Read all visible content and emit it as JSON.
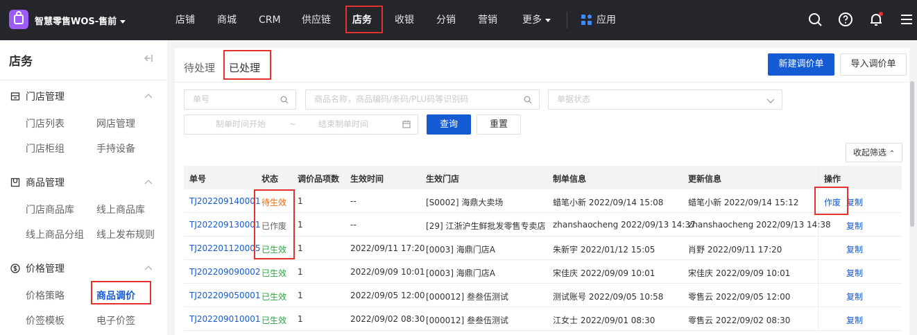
{
  "app": {
    "title": "智慧零售WOS-售前"
  },
  "nav": {
    "items": [
      "店铺",
      "商城",
      "CRM",
      "供应链",
      "店务",
      "收银",
      "分销",
      "营销",
      "更多"
    ],
    "apps_label": "应用",
    "active": "店务"
  },
  "toolbar_icons": [
    "search-icon",
    "help-icon",
    "bell-icon",
    "menu-icon"
  ],
  "sidebar": {
    "title": "店务",
    "groups": [
      {
        "label": "门店管理",
        "icon": "store-icon",
        "items": [
          "门店列表",
          "网店管理",
          "门店柜组",
          "手持设备"
        ]
      },
      {
        "label": "商品管理",
        "icon": "goods-icon",
        "items": [
          "门店商品库",
          "线上商品库",
          "线上商品分组",
          "线上发布规则"
        ]
      },
      {
        "label": "价格管理",
        "icon": "price-icon",
        "items": [
          "价格策略",
          "商品调价",
          "价签模板",
          "电子价签"
        ]
      }
    ],
    "active_item": "商品调价"
  },
  "tabs": {
    "pending": "待处理",
    "processed": "已处理"
  },
  "actions": {
    "new": "新建调价单",
    "import": "导入调价单"
  },
  "filters": {
    "order_no": "单号",
    "product": "商品名称，商品编码/条码/PLU码等识别码",
    "status": "单据状态",
    "date_start": "制单时间开始",
    "date_sep": "~",
    "date_end": "结束制单时间",
    "query": "查询",
    "reset": "重置",
    "collapse": "收起筛选"
  },
  "table": {
    "headers": [
      "单号",
      "状态",
      "调价品项数",
      "生效时间",
      "生效门店",
      "制单信息",
      "更新信息",
      "操作"
    ],
    "rows": [
      {
        "no": "TJ202209140001",
        "status": "待生效",
        "count": "1",
        "time": "--",
        "store": "[S0002] 海鼎大卖场",
        "creator": "蜡笔小新 2022/09/14 15:08",
        "updater": "蜡笔小新 2022/09/14 15:12",
        "ops": [
          "作废",
          "复制"
        ]
      },
      {
        "no": "TJ202209130001",
        "status": "已作废",
        "count": "1",
        "time": "--",
        "store": "[29] 江浙沪生鲜批发零售专卖店",
        "creator": "zhanshaocheng 2022/09/13 14:37",
        "updater": "zhanshaocheng 2022/09/13 14:38",
        "ops": [
          "复制"
        ]
      },
      {
        "no": "TJ202201120005",
        "status": "已生效",
        "count": "1",
        "time": "2022/09/11 17:20",
        "store": "[0003] 海鼎门店A",
        "creator": "朱新宇 2022/01/12 15:05",
        "updater": "肖野 2022/09/11 17:20",
        "ops": [
          "复制"
        ]
      },
      {
        "no": "TJ202209090002",
        "status": "已生效",
        "count": "1",
        "time": "2022/09/09 10:01",
        "store": "[0003] 海鼎门店A",
        "creator": "宋佳庆 2022/09/09 10:01",
        "updater": "宋佳庆 2022/09/09 10:01",
        "ops": [
          "复制"
        ]
      },
      {
        "no": "TJ202209050001",
        "status": "已生效",
        "count": "1",
        "time": "2022/09/05 12:00",
        "store": "[000012] 叁叁伍测试",
        "creator": "测试账号 2022/09/05 10:58",
        "updater": "零售云 2022/09/05 12:00",
        "ops": [
          "复制"
        ]
      },
      {
        "no": "TJ202209010001",
        "status": "已生效",
        "count": "1",
        "time": "2022/09/02 08:30",
        "store": "[000012] 叁叁伍测试",
        "creator": "江女士 2022/09/01 08:30",
        "updater": "零售云 2022/09/02 08:30",
        "ops": [
          "复制"
        ]
      }
    ]
  },
  "colors": {
    "accent": "#155bd4",
    "topbar": "#25262b",
    "highlight": "#e3312b",
    "pending": "#ed6a0c",
    "active": "#2da641",
    "void": "#646566"
  }
}
